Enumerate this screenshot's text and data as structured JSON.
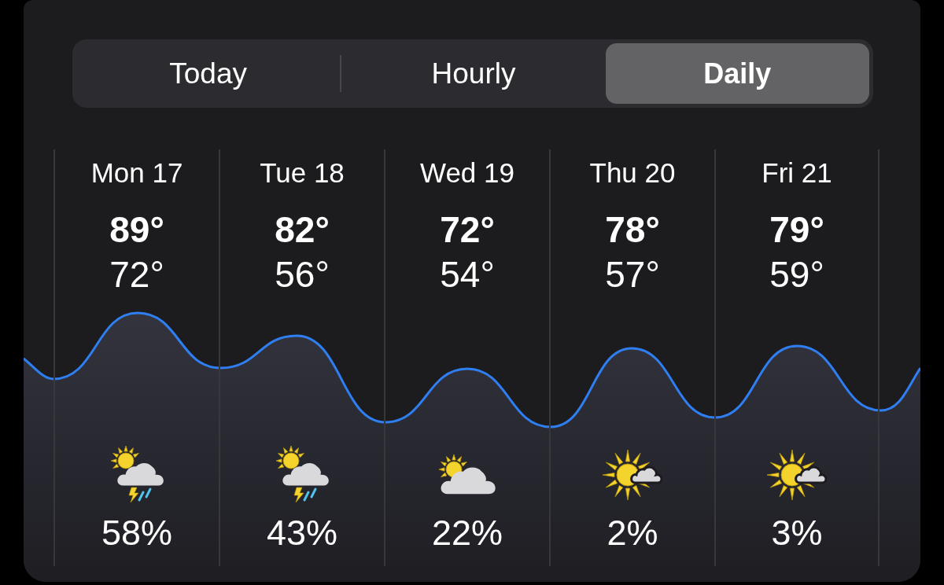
{
  "tabs": [
    {
      "label": "Today",
      "selected": false
    },
    {
      "label": "Hourly",
      "selected": false
    },
    {
      "label": "Daily",
      "selected": true
    }
  ],
  "days": [
    {
      "day": "Mon 17",
      "high": "89°",
      "low": "72°",
      "kind": "thunderstorm",
      "precipitation": "58%"
    },
    {
      "day": "Tue 18",
      "high": "82°",
      "low": "56°",
      "kind": "thunderstorm",
      "precipitation": "43%"
    },
    {
      "day": "Wed 19",
      "high": "72°",
      "low": "54°",
      "kind": "partly-cloudy",
      "precipitation": "22%"
    },
    {
      "day": "Thu 20",
      "high": "78°",
      "low": "57°",
      "kind": "mostly-sunny",
      "precipitation": "2%"
    },
    {
      "day": "Fri 21",
      "high": "79°",
      "low": "59°",
      "kind": "mostly-sunny",
      "precipitation": "3%"
    }
  ]
}
